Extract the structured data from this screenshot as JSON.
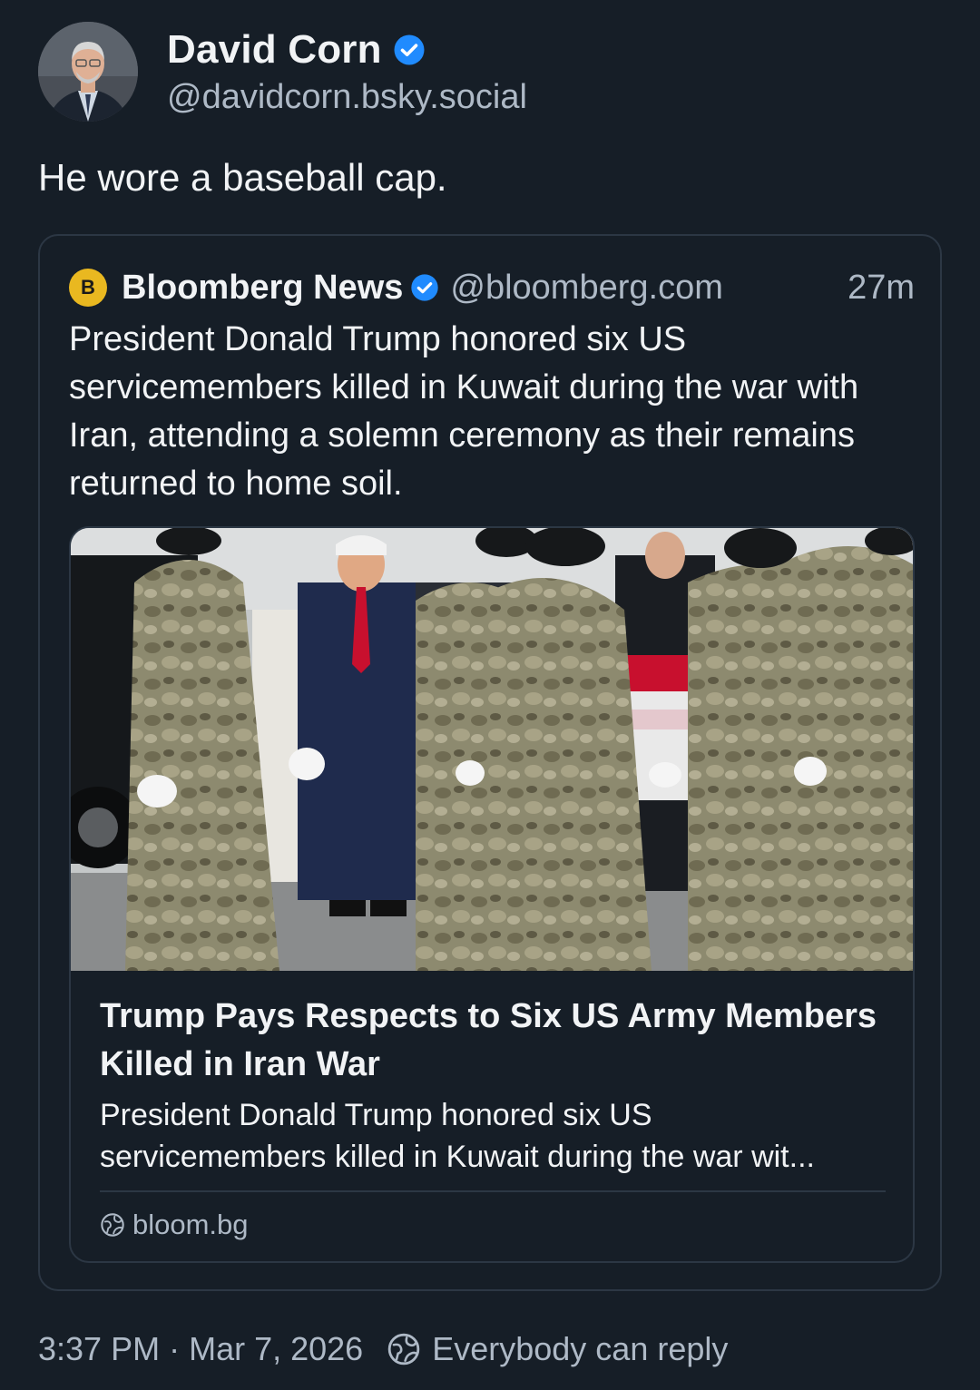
{
  "post": {
    "author": {
      "display_name": "David Corn",
      "handle": "@davidcorn.bsky.social",
      "verified": true
    },
    "text": "He wore a baseball cap.",
    "timestamp_time": "3:37 PM",
    "timestamp_sep": "·",
    "timestamp_date": "Mar 7, 2026",
    "reply_setting": "Everybody can reply"
  },
  "quote": {
    "avatar_letter": "B",
    "author_name": "Bloomberg News",
    "handle": "@bloomberg.com",
    "time_ago": "27m",
    "verified": true,
    "text": "President Donald Trump honored six US servicemembers killed in Kuwait during the war with Iran, attending a solemn ceremony as their remains returned to home soil."
  },
  "link_card": {
    "title": "Trump Pays Respects to Six US Army Members Killed in Iran War",
    "description_line1": "President Donald Trump honored six US",
    "description_line2": "servicemembers killed in Kuwait during the war wit...",
    "domain": "bloom.bg"
  },
  "colors": {
    "background": "#161e27",
    "text_primary": "#f1f3f5",
    "text_secondary": "#aeb9c6",
    "border": "#2c3744",
    "verified_blue": "#208bfe",
    "bloomberg_yellow": "#e9b820"
  },
  "icons": {
    "verified": "verified-check-icon",
    "globe": "globe-icon",
    "reply": "reply-globe-icon"
  }
}
